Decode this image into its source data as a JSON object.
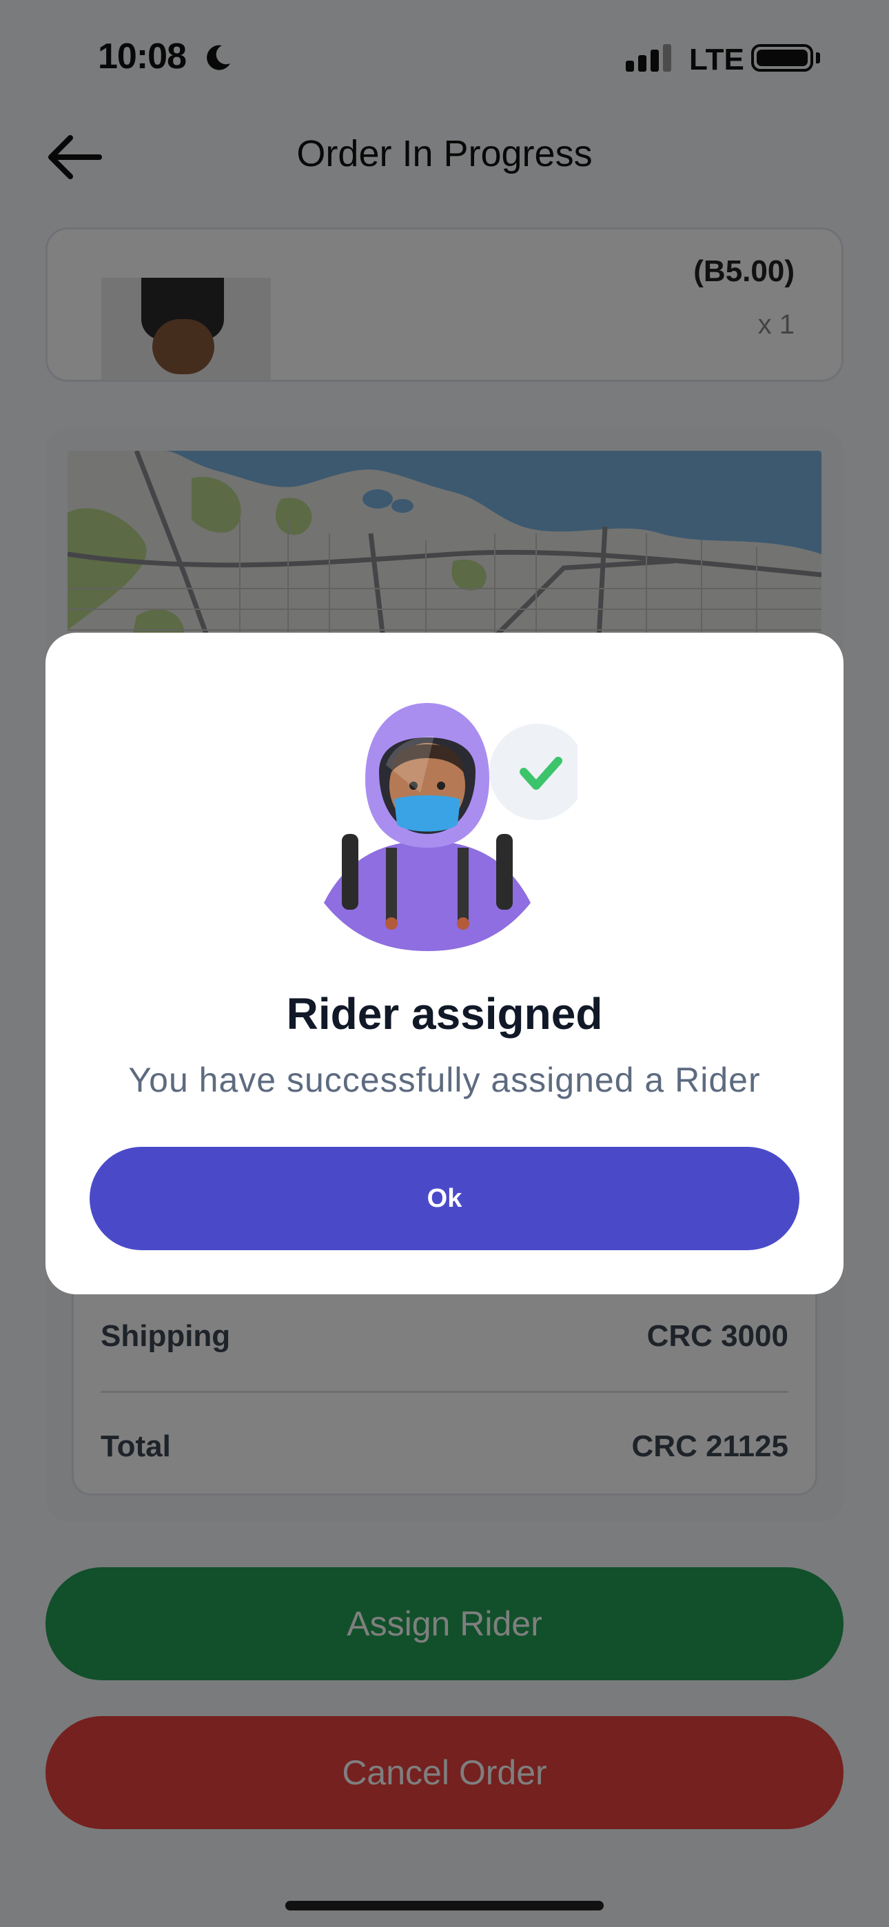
{
  "status_bar": {
    "time": "10:08",
    "network": "LTE"
  },
  "header": {
    "title": "Order In Progress"
  },
  "product": {
    "price": "(B5.00)",
    "quantity": "x 1"
  },
  "summary": {
    "shipping_label": "Shipping",
    "shipping_value": "CRC 3000",
    "total_label": "Total",
    "total_value": "CRC 21125"
  },
  "actions": {
    "assign_label": "Assign Rider",
    "cancel_label": "Cancel Order"
  },
  "modal": {
    "title": "Rider assigned",
    "message": "You have successfully assigned a Rider",
    "ok_label": "Ok"
  },
  "colors": {
    "primary": "#4a4ac9",
    "success": "#22a055",
    "danger": "#e8423f",
    "check": "#3cc46a"
  }
}
